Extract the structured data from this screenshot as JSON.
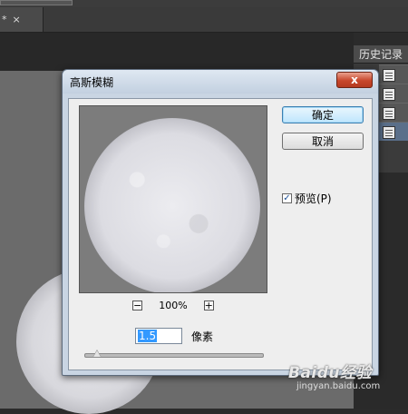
{
  "app": {
    "doc_tab": {
      "modified_mark": "*",
      "close": "×"
    }
  },
  "panel": {
    "title": "历史记录",
    "items": [
      {
        "icon": "document-icon",
        "selected": false
      },
      {
        "icon": "document-icon",
        "selected": false
      },
      {
        "icon": "document-icon",
        "selected": false
      },
      {
        "icon": "document-icon",
        "selected": true
      }
    ]
  },
  "dialog": {
    "title": "高斯模糊",
    "close_label": "x",
    "ok_label": "确定",
    "cancel_label": "取消",
    "preview_label": "预览(P)",
    "preview_checked": true,
    "zoom": {
      "minus": "−",
      "value": "100%",
      "plus": "+"
    },
    "radius": {
      "value": "1.5",
      "unit": "像素",
      "slider_fraction": 0.07
    }
  },
  "watermark": {
    "logo": "Baidu经验",
    "site": "jingyan.baidu.com"
  },
  "colors": {
    "dialog_frame": "#c9d5e3",
    "close_button": "#c8472b",
    "default_button": "#bee6fd",
    "canvas": "#6b6b6b",
    "selection": "#3399ff"
  }
}
